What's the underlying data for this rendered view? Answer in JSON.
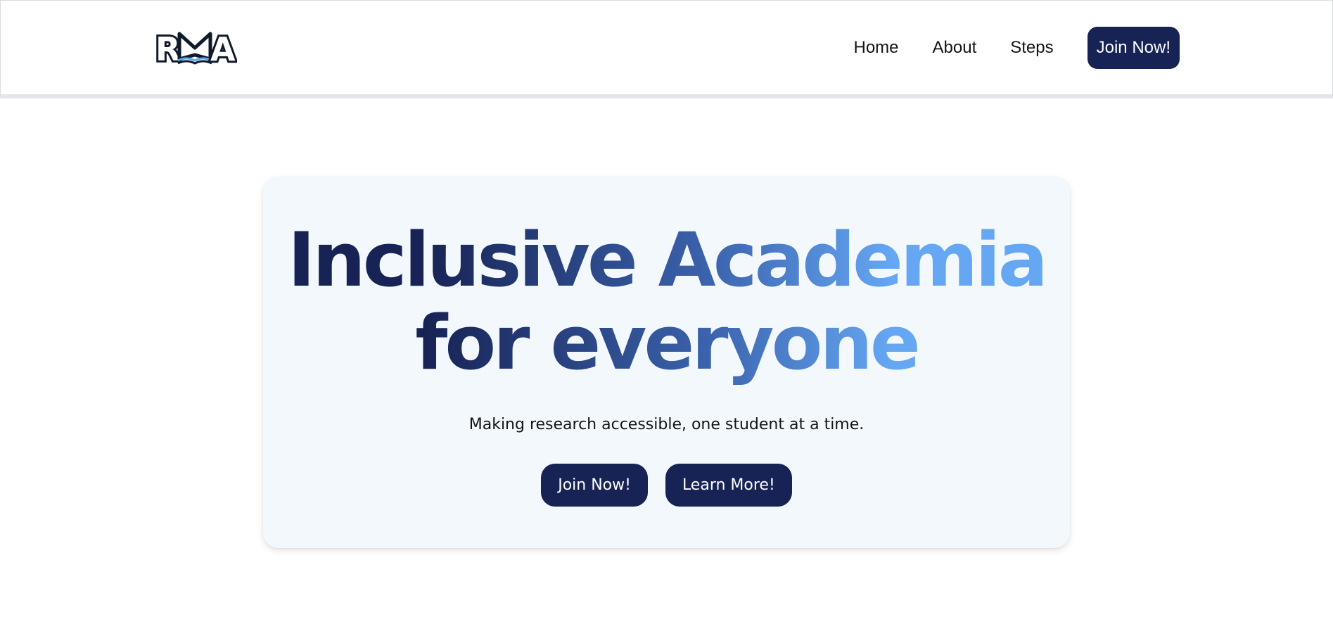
{
  "nav": {
    "logo_text": "RMA",
    "links": [
      {
        "label": "Home"
      },
      {
        "label": "About"
      },
      {
        "label": "Steps"
      }
    ],
    "join_label": "Join Now!"
  },
  "hero": {
    "title_line1": "Inclusive Academia",
    "title_line2": "for everyone",
    "subtitle": "Making research accessible, one student at a time.",
    "join_label": "Join Now!",
    "learn_label": "Learn More!"
  },
  "colors": {
    "navy": "#172354",
    "gradient_mid": "#3b62ac",
    "gradient_light": "#65a7f3",
    "hero_bg": "#f3f8fd"
  }
}
